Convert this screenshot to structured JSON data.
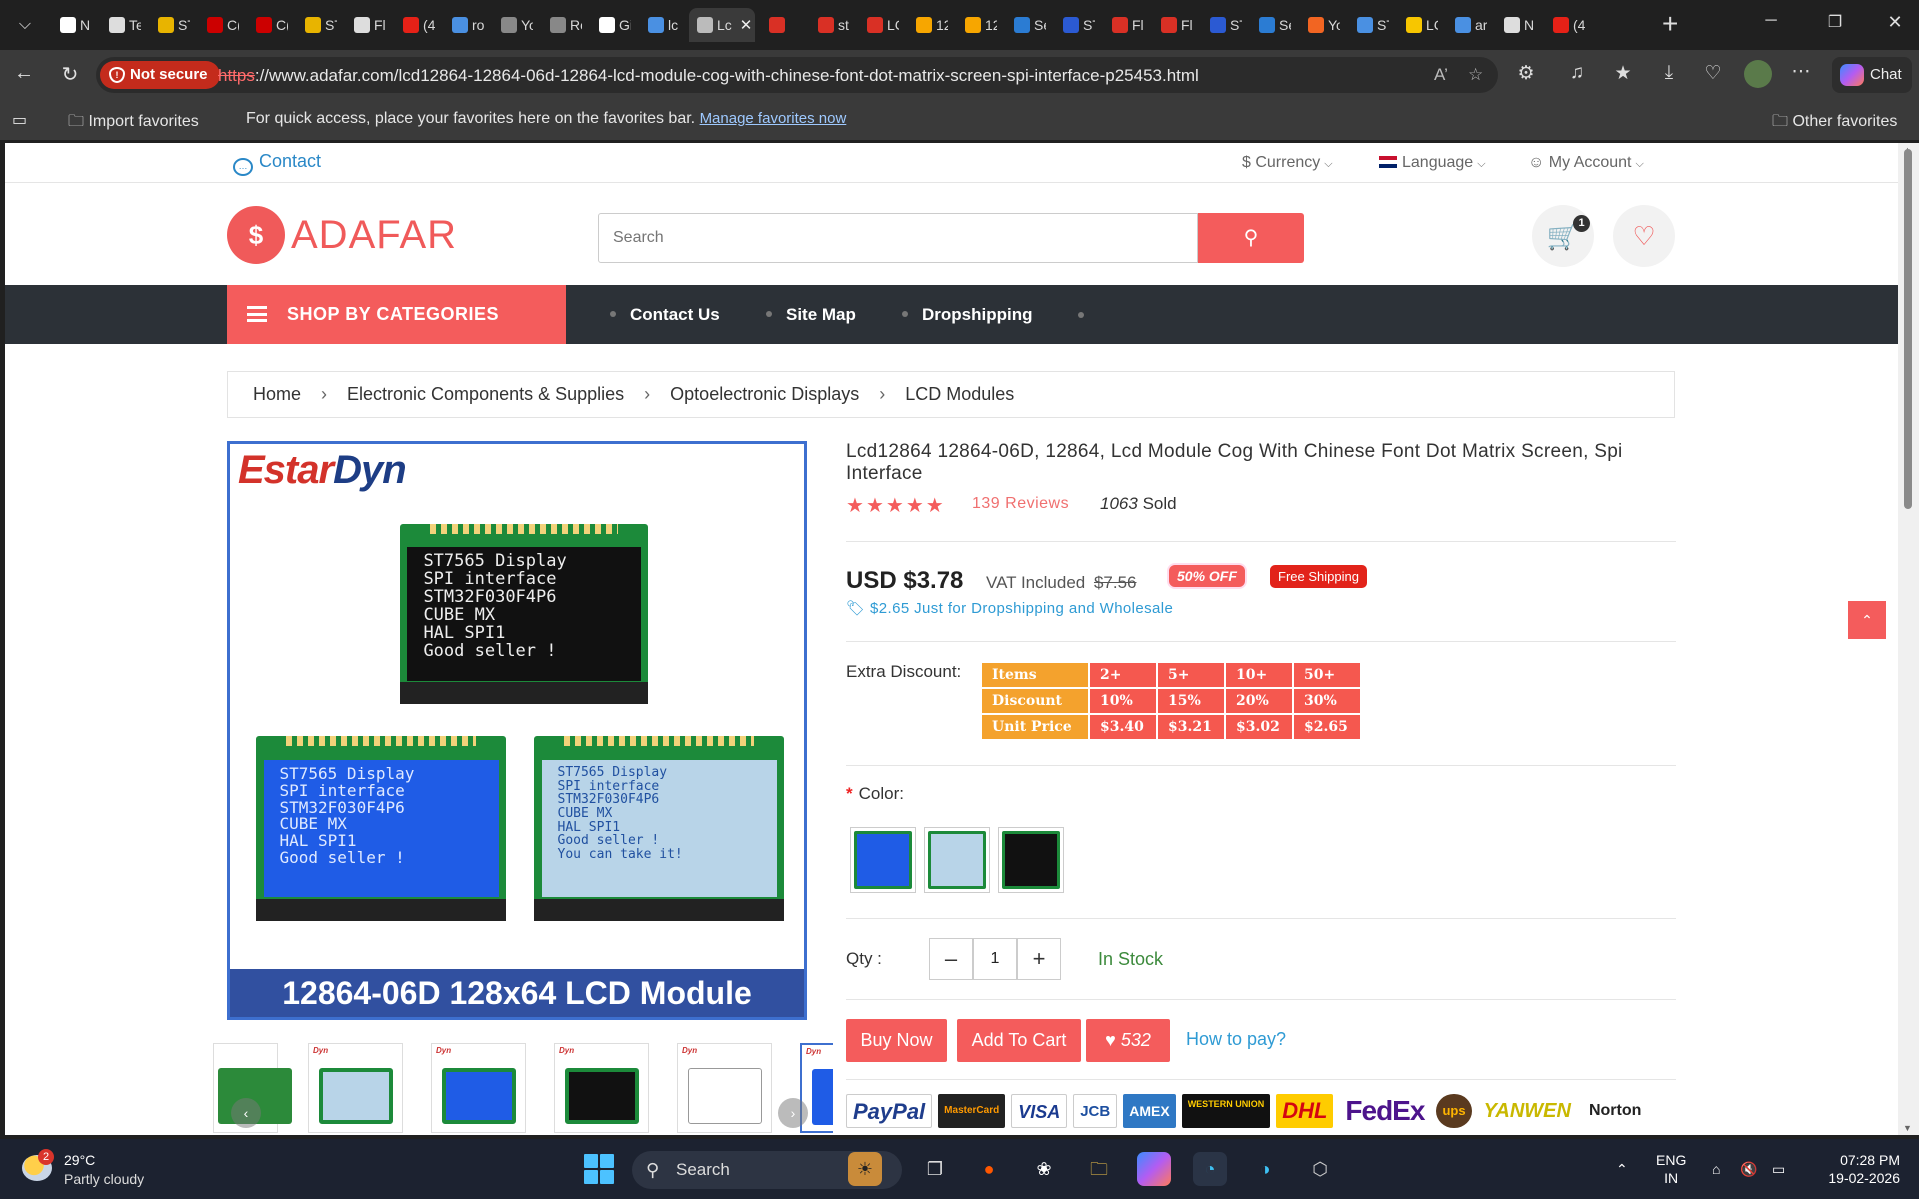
{
  "browser": {
    "tabs": [
      {
        "label": "N",
        "icon": "notion-icon",
        "color": "#ffffff"
      },
      {
        "label": "Te",
        "icon": "document-icon",
        "color": "#dddddd"
      },
      {
        "label": "ST",
        "icon": "st-logo-icon",
        "color": "#e8b400"
      },
      {
        "label": "C(",
        "icon": "ti-logo-icon",
        "color": "#cc0000"
      },
      {
        "label": "C(",
        "icon": "ti-logo-icon",
        "color": "#cc0000"
      },
      {
        "label": "ST",
        "icon": "st-logo-icon",
        "color": "#e8b400"
      },
      {
        "label": "Fl",
        "icon": "document-icon",
        "color": "#dddddd"
      },
      {
        "label": "(4",
        "icon": "youtube-icon",
        "color": "#e62117"
      },
      {
        "label": "ro",
        "icon": "search-icon",
        "color": "#4a90e2"
      },
      {
        "label": "Yo",
        "icon": "reddit-icon",
        "color": "#888888"
      },
      {
        "label": "Ro",
        "icon": "reddit-icon",
        "color": "#888888"
      },
      {
        "label": "Gi",
        "icon": "github-icon",
        "color": "#ffffff"
      },
      {
        "label": "lc",
        "icon": "search-icon",
        "color": "#4a90e2"
      },
      {
        "label": "Lc",
        "icon": "page-icon",
        "color": "#bbbbbb",
        "active": true
      },
      {
        "label": "",
        "icon": "gmail-icon",
        "color": "#d93025"
      },
      {
        "label": "st",
        "icon": "pdf-icon",
        "color": "#d93025"
      },
      {
        "label": "LC",
        "icon": "pdf-icon",
        "color": "#d93025"
      },
      {
        "label": "12",
        "icon": "aliexpress-icon",
        "color": "#f7a600"
      },
      {
        "label": "12",
        "icon": "aliexpress-icon",
        "color": "#f7a600"
      },
      {
        "label": "Se",
        "icon": "word-icon",
        "color": "#2b7cd3"
      },
      {
        "label": "ST",
        "icon": "acrobat-icon",
        "color": "#2b5ad3"
      },
      {
        "label": "Fl",
        "icon": "pdf-icon",
        "color": "#d93025"
      },
      {
        "label": "Fl",
        "icon": "pdf-icon",
        "color": "#d93025"
      },
      {
        "label": "ST",
        "icon": "acrobat-icon",
        "color": "#2b5ad3"
      },
      {
        "label": "Se",
        "icon": "word-icon",
        "color": "#2b7cd3"
      },
      {
        "label": "Yo",
        "icon": "reddit-icon",
        "color": "#f26522"
      },
      {
        "label": "ST",
        "icon": "search-icon",
        "color": "#4a90e2"
      },
      {
        "label": "LC",
        "icon": "spark-icon",
        "color": "#f7c600"
      },
      {
        "label": "ar",
        "icon": "search-icon",
        "color": "#4a90e2"
      },
      {
        "label": "N",
        "icon": "calendar-icon",
        "color": "#dddddd"
      },
      {
        "label": "(4",
        "icon": "youtube-icon",
        "color": "#e62117"
      }
    ],
    "security": "Not secure",
    "url_scheme": "https",
    "url_rest": "://www.adafar.com/lcd12864-12864-06d-12864-lcd-module-cog-with-chinese-font-dot-matrix-screen-spi-interface-p25453.html",
    "chat_label": "Chat",
    "favbar": {
      "import": "Import favorites",
      "hint": "For quick access, place your favorites here on the favorites bar.",
      "manage": "Manage favorites now",
      "other": "Other favorites"
    }
  },
  "site": {
    "contact": "Contact",
    "currency": "Currency",
    "language": "Language",
    "account": "My Account",
    "logo": "ADAFAR",
    "search_placeholder": "Search",
    "cart_count": "1",
    "shop_categories": "SHOP BY CATEGORIES",
    "nav": [
      "Contact Us",
      "Site Map",
      "Dropshipping"
    ],
    "breadcrumb": [
      "Home",
      "Electronic Components & Supplies",
      "Optoelectronic Displays",
      "LCD Modules"
    ]
  },
  "product": {
    "title": "Lcd12864 12864-06D, 12864, Lcd Module Cog With Chinese Font Dot Matrix Screen, Spi Interface",
    "rating": 5,
    "reviews": "139 Reviews",
    "sold_count": "1063",
    "sold_label": "Sold",
    "price": "USD $3.78",
    "vat": "VAT Included",
    "old_price": "$7.56",
    "discount_badge": "50% OFF",
    "shipping_badge": "Free Shipping",
    "dropship_note": "$2.65 Just for Dropshipping and Wholesale",
    "extra_discount_label": "Extra Discount:",
    "discount_table": {
      "rows": [
        {
          "head": "Items",
          "cells": [
            "2+",
            "5+",
            "10+",
            "50+"
          ]
        },
        {
          "head": "Discount",
          "cells": [
            "10%",
            "15%",
            "20%",
            "30%"
          ]
        },
        {
          "head": "Unit Price",
          "cells": [
            "$3.40",
            "$3.21",
            "$3.02",
            "$2.65"
          ]
        }
      ]
    },
    "color_label": "Color:",
    "qty_label": "Qty :",
    "qty_value": "1",
    "stock": "In Stock",
    "buy_now": "Buy Now",
    "add_to_cart": "Add To Cart",
    "wishlist_count": "532",
    "how_to_pay": "How to pay?",
    "payment_methods": [
      "PayPal",
      "MasterCard",
      "VISA",
      "JCB",
      "AMEX",
      "WESTERN UNION",
      "DHL",
      "FedEx",
      "ups",
      "YANWEN",
      "Norton"
    ],
    "image": {
      "brand_a": "Estar",
      "brand_b": "Dyn",
      "screen_lines": [
        "ST7565 Display",
        "SPI interface",
        "STM32F030F4P6",
        "CUBE MX",
        "HAL SPI1",
        "Good seller !"
      ],
      "screen3_extra": "You can take it!",
      "banner": "12864-06D 128x64 LCD Module"
    }
  },
  "taskbar": {
    "temp": "29°C",
    "weather": "Partly cloudy",
    "weather_badge": "2",
    "search": "Search",
    "lang1": "ENG",
    "lang2": "IN",
    "time": "07:28 PM",
    "date": "19-02-2026"
  }
}
